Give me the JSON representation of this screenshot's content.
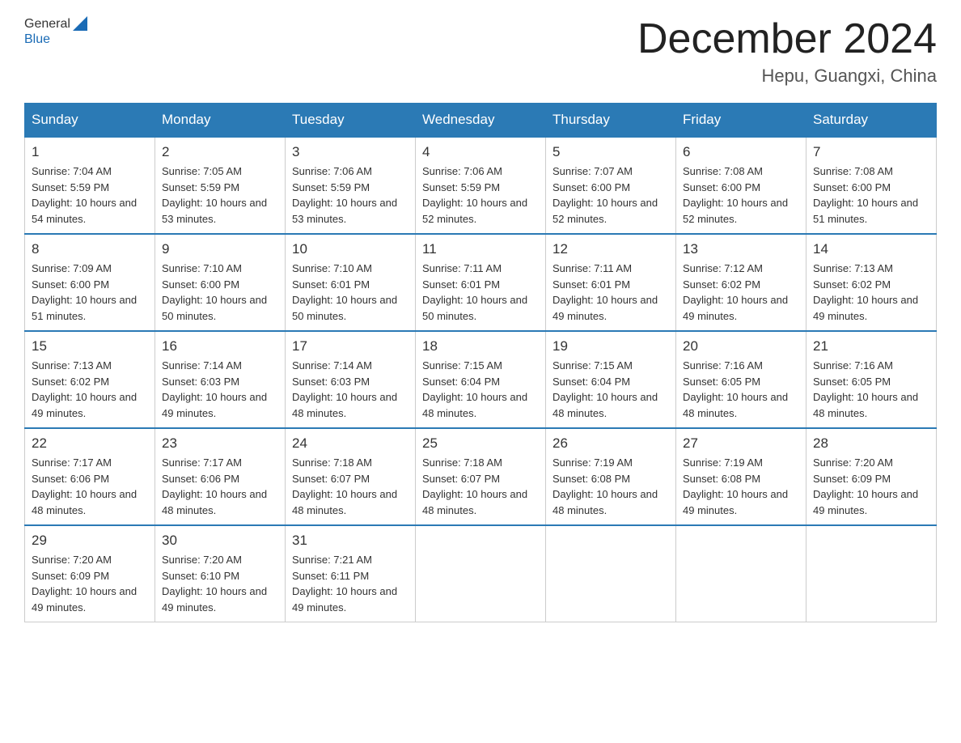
{
  "logo": {
    "general": "General",
    "blue": "Blue"
  },
  "title": "December 2024",
  "location": "Hepu, Guangxi, China",
  "headers": [
    "Sunday",
    "Monday",
    "Tuesday",
    "Wednesday",
    "Thursday",
    "Friday",
    "Saturday"
  ],
  "weeks": [
    [
      {
        "day": "1",
        "sunrise": "7:04 AM",
        "sunset": "5:59 PM",
        "daylight": "10 hours and 54 minutes."
      },
      {
        "day": "2",
        "sunrise": "7:05 AM",
        "sunset": "5:59 PM",
        "daylight": "10 hours and 53 minutes."
      },
      {
        "day": "3",
        "sunrise": "7:06 AM",
        "sunset": "5:59 PM",
        "daylight": "10 hours and 53 minutes."
      },
      {
        "day": "4",
        "sunrise": "7:06 AM",
        "sunset": "5:59 PM",
        "daylight": "10 hours and 52 minutes."
      },
      {
        "day": "5",
        "sunrise": "7:07 AM",
        "sunset": "6:00 PM",
        "daylight": "10 hours and 52 minutes."
      },
      {
        "day": "6",
        "sunrise": "7:08 AM",
        "sunset": "6:00 PM",
        "daylight": "10 hours and 52 minutes."
      },
      {
        "day": "7",
        "sunrise": "7:08 AM",
        "sunset": "6:00 PM",
        "daylight": "10 hours and 51 minutes."
      }
    ],
    [
      {
        "day": "8",
        "sunrise": "7:09 AM",
        "sunset": "6:00 PM",
        "daylight": "10 hours and 51 minutes."
      },
      {
        "day": "9",
        "sunrise": "7:10 AM",
        "sunset": "6:00 PM",
        "daylight": "10 hours and 50 minutes."
      },
      {
        "day": "10",
        "sunrise": "7:10 AM",
        "sunset": "6:01 PM",
        "daylight": "10 hours and 50 minutes."
      },
      {
        "day": "11",
        "sunrise": "7:11 AM",
        "sunset": "6:01 PM",
        "daylight": "10 hours and 50 minutes."
      },
      {
        "day": "12",
        "sunrise": "7:11 AM",
        "sunset": "6:01 PM",
        "daylight": "10 hours and 49 minutes."
      },
      {
        "day": "13",
        "sunrise": "7:12 AM",
        "sunset": "6:02 PM",
        "daylight": "10 hours and 49 minutes."
      },
      {
        "day": "14",
        "sunrise": "7:13 AM",
        "sunset": "6:02 PM",
        "daylight": "10 hours and 49 minutes."
      }
    ],
    [
      {
        "day": "15",
        "sunrise": "7:13 AM",
        "sunset": "6:02 PM",
        "daylight": "10 hours and 49 minutes."
      },
      {
        "day": "16",
        "sunrise": "7:14 AM",
        "sunset": "6:03 PM",
        "daylight": "10 hours and 49 minutes."
      },
      {
        "day": "17",
        "sunrise": "7:14 AM",
        "sunset": "6:03 PM",
        "daylight": "10 hours and 48 minutes."
      },
      {
        "day": "18",
        "sunrise": "7:15 AM",
        "sunset": "6:04 PM",
        "daylight": "10 hours and 48 minutes."
      },
      {
        "day": "19",
        "sunrise": "7:15 AM",
        "sunset": "6:04 PM",
        "daylight": "10 hours and 48 minutes."
      },
      {
        "day": "20",
        "sunrise": "7:16 AM",
        "sunset": "6:05 PM",
        "daylight": "10 hours and 48 minutes."
      },
      {
        "day": "21",
        "sunrise": "7:16 AM",
        "sunset": "6:05 PM",
        "daylight": "10 hours and 48 minutes."
      }
    ],
    [
      {
        "day": "22",
        "sunrise": "7:17 AM",
        "sunset": "6:06 PM",
        "daylight": "10 hours and 48 minutes."
      },
      {
        "day": "23",
        "sunrise": "7:17 AM",
        "sunset": "6:06 PM",
        "daylight": "10 hours and 48 minutes."
      },
      {
        "day": "24",
        "sunrise": "7:18 AM",
        "sunset": "6:07 PM",
        "daylight": "10 hours and 48 minutes."
      },
      {
        "day": "25",
        "sunrise": "7:18 AM",
        "sunset": "6:07 PM",
        "daylight": "10 hours and 48 minutes."
      },
      {
        "day": "26",
        "sunrise": "7:19 AM",
        "sunset": "6:08 PM",
        "daylight": "10 hours and 48 minutes."
      },
      {
        "day": "27",
        "sunrise": "7:19 AM",
        "sunset": "6:08 PM",
        "daylight": "10 hours and 49 minutes."
      },
      {
        "day": "28",
        "sunrise": "7:20 AM",
        "sunset": "6:09 PM",
        "daylight": "10 hours and 49 minutes."
      }
    ],
    [
      {
        "day": "29",
        "sunrise": "7:20 AM",
        "sunset": "6:09 PM",
        "daylight": "10 hours and 49 minutes."
      },
      {
        "day": "30",
        "sunrise": "7:20 AM",
        "sunset": "6:10 PM",
        "daylight": "10 hours and 49 minutes."
      },
      {
        "day": "31",
        "sunrise": "7:21 AM",
        "sunset": "6:11 PM",
        "daylight": "10 hours and 49 minutes."
      },
      null,
      null,
      null,
      null
    ]
  ]
}
